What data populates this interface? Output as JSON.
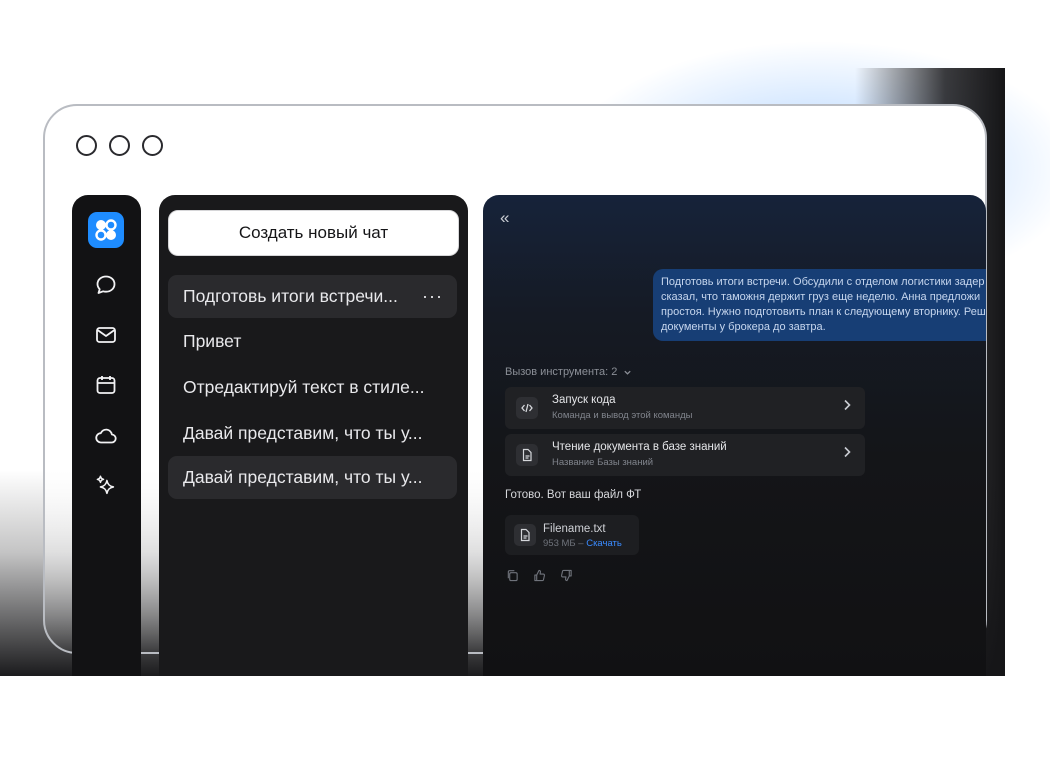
{
  "window": {
    "controls": [
      "circle",
      "circle",
      "circle"
    ]
  },
  "sidebar": {
    "logo": "app-logo-icon",
    "items": [
      {
        "name": "chat-icon"
      },
      {
        "name": "mail-icon"
      },
      {
        "name": "calendar-icon"
      },
      {
        "name": "cloud-icon"
      },
      {
        "name": "sparkles-icon"
      }
    ],
    "accent": "#1e8cff"
  },
  "chat_list": {
    "new_chat_label": "Создать новый чат",
    "items": [
      {
        "title": "Подготовь итоги встречи...",
        "more": "···",
        "active": true
      },
      {
        "title": "Привет"
      },
      {
        "title": "Отредактируй текст в стиле..."
      },
      {
        "title": "Давай представим, что ты у..."
      },
      {
        "title": "Давай представим, что ты у...",
        "hovered": true
      }
    ]
  },
  "conversation": {
    "collapse_icon": "«",
    "user_message": "Подготовь итоги встречи. Обсудили с отделом логистики задер\nсказал, что таможня держит груз еще неделю. Анна предложи\nпростоя. Нужно подготовить план к следующему вторнику. Реш\nдокументы у брокера до завтра.",
    "tool_calls_header": "Вызов инструмента: 2",
    "tools": [
      {
        "title": "Запуск кода",
        "subtitle": "Команда и вывод этой команды",
        "icon": "code-icon"
      },
      {
        "title": "Чтение документа в базе знаний",
        "subtitle": "Название Базы знаний",
        "icon": "document-icon"
      }
    ],
    "answer": "Готово. Вот ваш файл ФТ",
    "file": {
      "name": "Filename.txt",
      "size": "953 МБ – ",
      "download": "Скачать"
    },
    "actions": [
      "copy-icon",
      "thumbs-up-icon",
      "thumbs-down-icon"
    ],
    "bubble_color": "#173e75",
    "link_color": "#3a8bff"
  }
}
